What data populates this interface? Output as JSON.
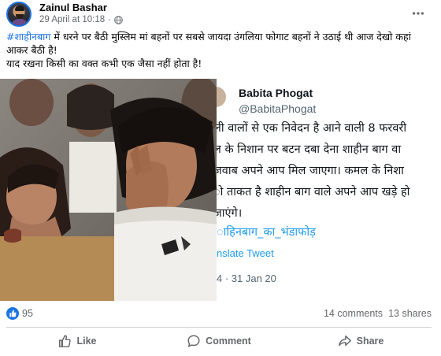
{
  "post": {
    "author": "Zainul Bashar",
    "timestamp": "29 April at 10:18",
    "separator": "·",
    "audience_icon": "globe-icon",
    "menu_icon": "more-options-icon",
    "caption_hashtag": "#शाहीनबाग",
    "caption_line1": " में धरने पर बैठी मुस्लिम मां बहनों  पर सबसे जायदा उंगलिया फोगाट बहनों ने उठाई थी आज देखो कहां आकर बैठी है!",
    "caption_line2": "याद रखना किसी का वक्त कभी एक जैसा नहीं होता है!"
  },
  "tweet": {
    "name": "Babita Phogat",
    "handle": "@BabitaPhogat",
    "lines": [
      "ली वालों से एक निवेदन है आने वाली 8 फरवरी",
      "ल के निशान पर बटन दबा देना  शाहीन बाग वा",
      "जवाब अपने आप मिल जाएगा। कमल के निशा",
      "ो ताकत है शाहीन बाग वाले अपने आप खड़े हो",
      " जाएंगे।"
    ],
    "hashtag": "ाहिनबाग_का_भंडाफोड़",
    "translate": "nslate Tweet",
    "date": "4 · 31 Jan 20"
  },
  "stats": {
    "reactions": "95",
    "comments": "14 comments",
    "shares": "13 shares"
  },
  "actions": {
    "like": "Like",
    "comment": "Comment",
    "share": "Share"
  },
  "colors": {
    "facebook_blue": "#1b74e4",
    "twitter_blue": "#1d9bf0",
    "secondary_text": "#65676b"
  }
}
